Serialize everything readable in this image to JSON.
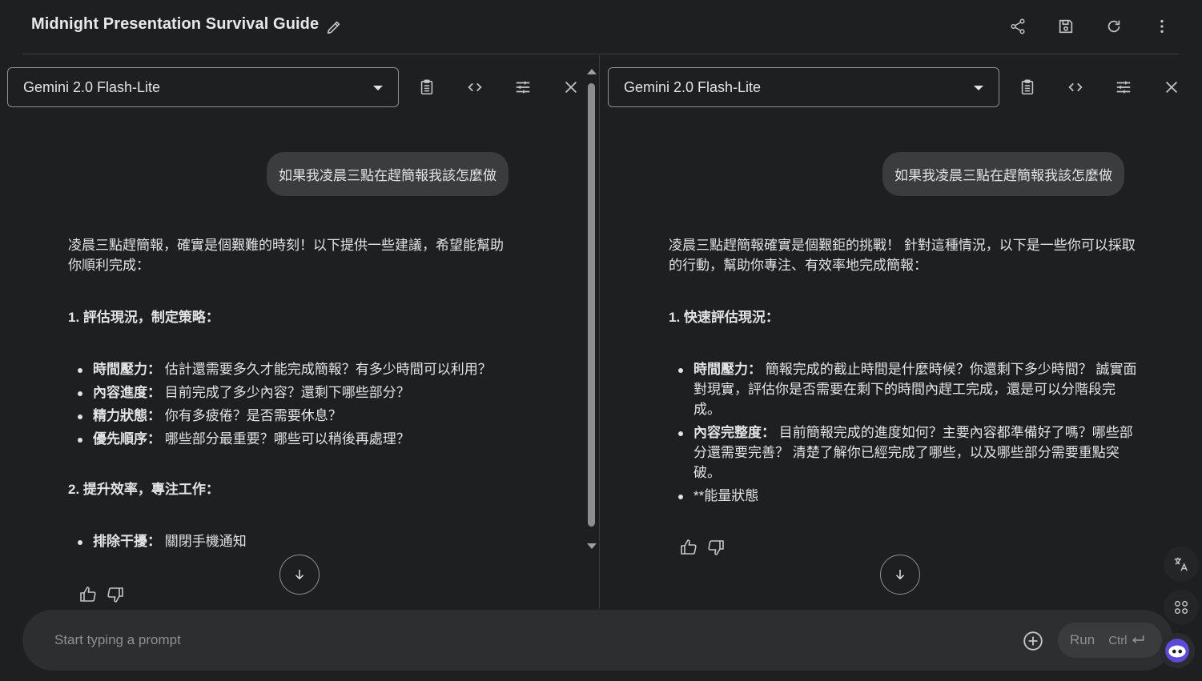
{
  "header": {
    "title": "Midnight Presentation Survival Guide",
    "icons": [
      "edit-icon",
      "share-icon",
      "save-icon",
      "refresh-icon",
      "more-vert-icon"
    ]
  },
  "panels": [
    {
      "model": "Gemini 2.0 Flash-Lite",
      "tools": [
        "clipboard-icon",
        "code-icon",
        "tune-icon",
        "close-icon"
      ],
      "user_message": "如果我凌晨三點在趕簡報我該怎麼做",
      "intro": "凌晨三點趕簡報，確實是個艱難的時刻！以下提供一些建議，希望能幫助你順利完成：",
      "sections": [
        {
          "heading": "1. 評估現況，制定策略：",
          "items": [
            {
              "bold": "時間壓力：",
              "text": " 估計還需要多久才能完成簡報？有多少時間可以利用？"
            },
            {
              "bold": "內容進度：",
              "text": " 目前完成了多少內容？還剩下哪些部分？"
            },
            {
              "bold": "精力狀態：",
              "text": " 你有多疲倦？是否需要休息？"
            },
            {
              "bold": "優先順序：",
              "text": " 哪些部分最重要？哪些可以稍後再處理？"
            }
          ]
        },
        {
          "heading": "2. 提升效率，專注工作：",
          "items": [
            {
              "bold": "排除干擾：",
              "text": " 關閉手機通知"
            }
          ]
        }
      ]
    },
    {
      "model": "Gemini 2.0 Flash-Lite",
      "tools": [
        "clipboard-icon",
        "code-icon",
        "tune-icon",
        "close-icon"
      ],
      "user_message": "如果我凌晨三點在趕簡報我該怎麼做",
      "intro": "凌晨三點趕簡報確實是個艱鉅的挑戰！ 針對這種情況，以下是一些你可以採取的行動，幫助你專注、有效率地完成簡報：",
      "sections": [
        {
          "heading": "1. 快速評估現況：",
          "items": [
            {
              "bold": "時間壓力：",
              "text": " 簡報完成的截止時間是什麼時候？你還剩下多少時間？ 誠實面對現實，評估你是否需要在剩下的時間內趕工完成，還是可以分階段完成。"
            },
            {
              "bold": "內容完整度：",
              "text": " 目前簡報完成的進度如何？主要內容都準備好了嗎？哪些部分還需要完善？ 清楚了解你已經完成了哪些，以及哪些部分需要重點突破。"
            },
            {
              "bold": "",
              "text": "**能量狀態"
            }
          ]
        }
      ]
    }
  ],
  "prompt": {
    "placeholder": "Start typing a prompt",
    "run_label": "Run",
    "shortcut": "Ctrl"
  },
  "colors": {
    "background": "#1e1f20",
    "bubble": "#3b3c3e",
    "prompt_bar": "#2d2e30",
    "text": "#e3e3e3",
    "muted": "#8e918f"
  }
}
